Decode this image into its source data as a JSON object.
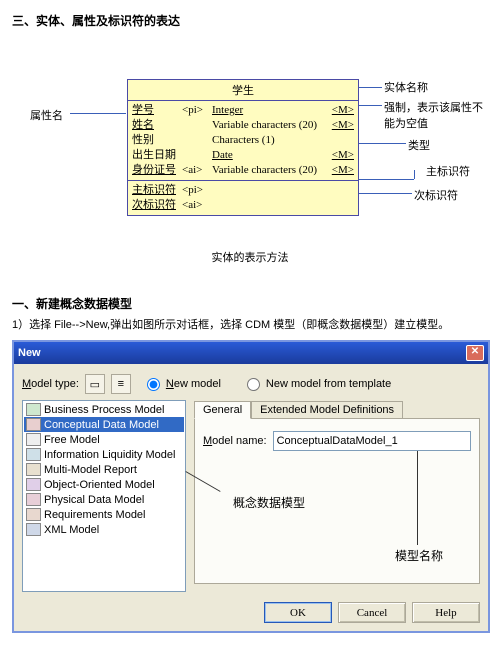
{
  "section1_title": "三、实体、属性及标识符的表达",
  "entity": {
    "title_cell": "学生",
    "attrs": [
      {
        "name": "学号",
        "tag": "<pi>",
        "type": "Integer",
        "m": "<M>",
        "name_u": true,
        "type_u": true
      },
      {
        "name": "姓名",
        "tag": "",
        "type": "Variable characters (20)",
        "m": "<M>",
        "name_u": true,
        "type_u": false
      },
      {
        "name": "性别",
        "tag": "",
        "type": "Characters (1)",
        "m": "",
        "name_u": false,
        "type_u": false
      },
      {
        "name": "出生日期",
        "tag": "",
        "type": "Date",
        "m": "<M>",
        "name_u": false,
        "type_u": true
      },
      {
        "name": "身份证号",
        "tag": "<ai>",
        "type": "Variable characters (20)",
        "m": "<M>",
        "name_u": true,
        "type_u": false
      }
    ],
    "ids": [
      {
        "name": "主标识符",
        "tag": "<pi>"
      },
      {
        "name": "次标识符",
        "tag": "<ai>"
      }
    ]
  },
  "labels": {
    "attr_name": "属性名",
    "entity_name": "实体名称",
    "mandatory": "强制，表示该属性不能为空值",
    "type": "类型",
    "pi": "主标识符",
    "ai": "次标识符"
  },
  "caption": "实体的表示方法",
  "section2_title": "一、新建概念数据模型",
  "step1": "1）选择 File-->New,弹出如图所示对话框，选择 CDM 模型（即概念数据模型）建立模型。",
  "dialog": {
    "title": "New",
    "modeltype_label": "Model type:",
    "radio_new": "New model",
    "radio_template": "New model from template",
    "tree": [
      "Business Process Model",
      "Conceptual Data Model",
      "Free Model",
      "Information Liquidity Model",
      "Multi-Model Report",
      "Object-Oriented Model",
      "Physical Data Model",
      "Requirements Model",
      "XML Model"
    ],
    "tree_selected": 1,
    "tab_general": "General",
    "tab_extended": "Extended Model Definitions",
    "modelname_label": "Model name:",
    "modelname_value": "ConceptualDataModel_1",
    "anno_cdm": "概念数据模型",
    "anno_name": "模型名称",
    "btn_ok": "OK",
    "btn_cancel": "Cancel",
    "btn_help": "Help"
  }
}
